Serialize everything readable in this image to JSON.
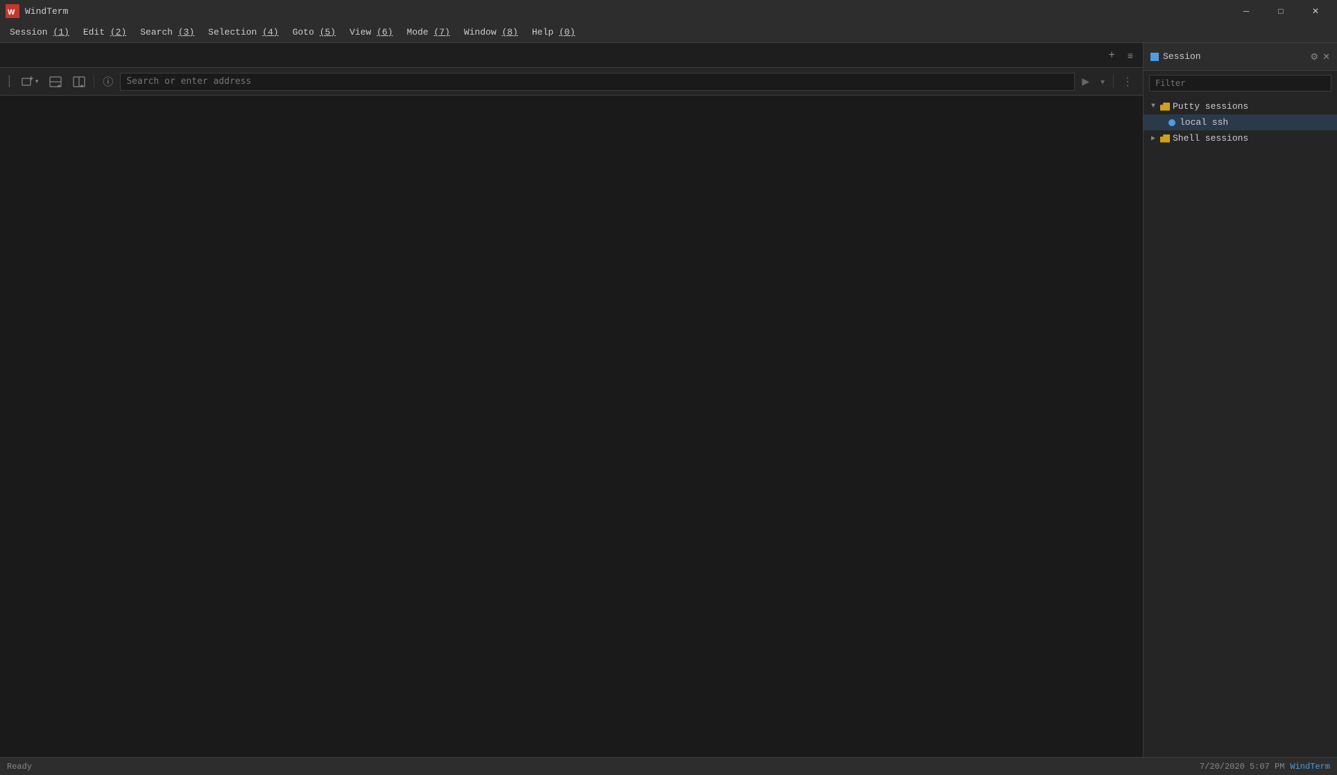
{
  "titlebar": {
    "logo_label": "WT",
    "title": "WindTerm",
    "btn_minimize": "─",
    "btn_maximize": "□",
    "btn_close": "✕"
  },
  "menubar": {
    "items": [
      {
        "label": "Session (1)",
        "id": "session"
      },
      {
        "label": "Edit (2)",
        "id": "edit"
      },
      {
        "label": "Search (3)",
        "id": "search"
      },
      {
        "label": "Selection (4)",
        "id": "selection"
      },
      {
        "label": "Goto (5)",
        "id": "goto"
      },
      {
        "label": "View (6)",
        "id": "view"
      },
      {
        "label": "Mode (7)",
        "id": "mode"
      },
      {
        "label": "Window (8)",
        "id": "window"
      },
      {
        "label": "Help (0)",
        "id": "help"
      }
    ]
  },
  "toolbar": {
    "new_session_label": "⊞",
    "split_h_label": "⧉",
    "split_v_label": "⧈",
    "info_label": "ⓘ",
    "address_placeholder": "Search or enter address",
    "go_label": "▶",
    "dropdown_label": "▾",
    "more_label": "⋮"
  },
  "tabs_controls": {
    "add_tab": "+",
    "tab_menu": "≡"
  },
  "right_panel": {
    "title": "Session",
    "filter_placeholder": "Filter",
    "gear_label": "⚙",
    "close_label": "✕",
    "tree": {
      "putty_group": {
        "label": "Putty sessions",
        "expanded": true,
        "items": [
          {
            "label": "local ssh",
            "status": "connected",
            "active": true
          }
        ]
      },
      "shell_group": {
        "label": "Shell sessions",
        "expanded": false,
        "items": []
      }
    }
  },
  "statusbar": {
    "status": "Ready",
    "datetime": "7/20/2020  5:07 PM",
    "brand": "WindTerm"
  }
}
